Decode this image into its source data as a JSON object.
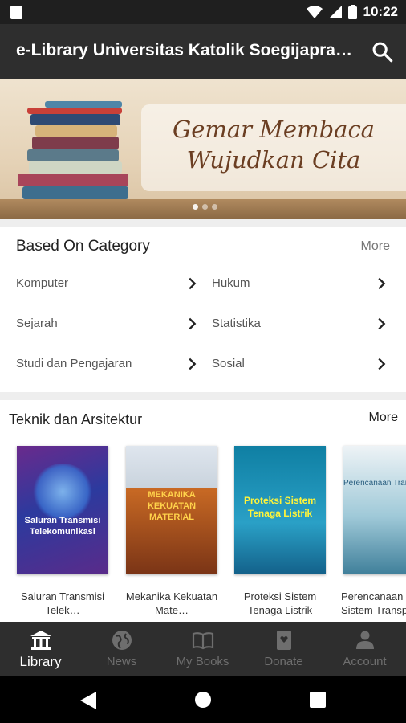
{
  "status_bar": {
    "time": "10:22",
    "icons": [
      "sd-card-icon",
      "wifi-icon",
      "signal-icon",
      "battery-icon"
    ]
  },
  "app_bar": {
    "title": "e-Library Universitas Katolik Soegijapranata",
    "search_icon": "search-icon"
  },
  "banner": {
    "slogan_line1": "Gemar Membaca",
    "slogan_line2": "Wujudkan Cita"
  },
  "category_section": {
    "title": "Based On Category",
    "more_label": "More",
    "items": [
      {
        "label": "Komputer"
      },
      {
        "label": "Hukum"
      },
      {
        "label": "Sejarah"
      },
      {
        "label": "Statistika"
      },
      {
        "label": "Studi dan Pengajaran"
      },
      {
        "label": "Sosial"
      }
    ]
  },
  "books_section": {
    "title": "Teknik dan Arsitektur",
    "more_label": "More",
    "books": [
      {
        "cover_title": "Saluran Transmisi Telekomunikasi",
        "caption": "Saluran Transmisi Telek…"
      },
      {
        "cover_title": "MEKANIKA KEKUATAN MATERIAL",
        "caption": "Mekanika Kekuatan Mate…"
      },
      {
        "cover_title": "Proteksi Sistem Tenaga Listrik",
        "caption": "Proteksi Sistem Tenaga Listrik"
      },
      {
        "cover_title": "Perencanaan Transportasi",
        "caption": "Perencanaan Sistem Transportasi"
      }
    ]
  },
  "bottom_nav": {
    "items": [
      {
        "label": "Library",
        "icon": "library-icon",
        "active": true
      },
      {
        "label": "News",
        "icon": "globe-icon",
        "active": false
      },
      {
        "label": "My Books",
        "icon": "open-book-icon",
        "active": false
      },
      {
        "label": "Donate",
        "icon": "donate-book-icon",
        "active": false
      },
      {
        "label": "Account",
        "icon": "account-icon",
        "active": false
      }
    ]
  },
  "colors": {
    "app_bar": "#2e2e2e",
    "status_bar": "#1f1f1f",
    "nav_active": "#ffffff",
    "nav_inactive": "#6e6e6e",
    "slogan": "#6b3e22"
  }
}
